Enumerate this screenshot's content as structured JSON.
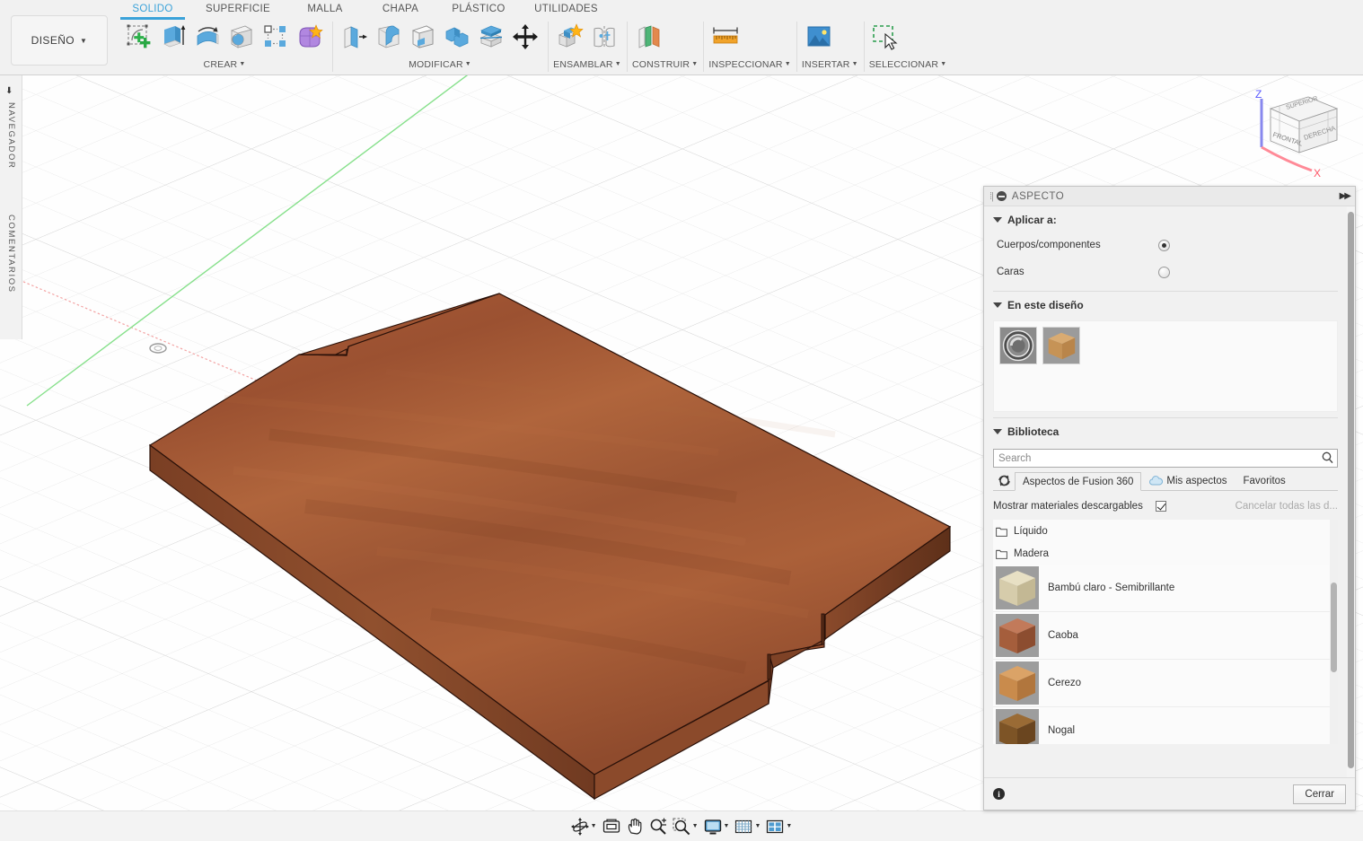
{
  "app": {
    "workspace_button": "DISEÑO",
    "ribbon_tabs": [
      {
        "label": "SOLIDO",
        "active": true
      },
      {
        "label": "SUPERFICIE",
        "active": false
      },
      {
        "label": "MALLA",
        "active": false
      },
      {
        "label": "CHAPA",
        "active": false
      },
      {
        "label": "PLÁSTICO",
        "active": false
      },
      {
        "label": "UTILIDADES",
        "active": false
      }
    ],
    "ribbon_groups": [
      {
        "label": "CREAR",
        "has_caret": true,
        "icons": [
          "create-sketch-icon",
          "extrude-icon",
          "revolve-icon",
          "sphere-hole-icon",
          "pattern-icon",
          "form-icon"
        ]
      },
      {
        "label": "MODIFICAR",
        "has_caret": true,
        "icons": [
          "press-pull-icon",
          "fillet-icon",
          "shell-icon",
          "combine-icon",
          "offset-face-icon",
          "move-copy-icon"
        ]
      },
      {
        "label": "ENSAMBLAR",
        "has_caret": true,
        "icons": [
          "new-component-icon",
          "joint-icon"
        ]
      },
      {
        "label": "CONSTRUIR",
        "has_caret": true,
        "icons": [
          "construct-plane-icon"
        ]
      },
      {
        "label": "INSPECCIONAR",
        "has_caret": true,
        "icons": [
          "measure-icon"
        ]
      },
      {
        "label": "INSERTAR",
        "has_caret": true,
        "icons": [
          "insert-image-icon"
        ]
      },
      {
        "label": "SELECCIONAR",
        "has_caret": true,
        "icons": [
          "window-selection-icon"
        ]
      }
    ]
  },
  "left_rail": {
    "navigator_label": "NAVEGADOR",
    "comments_label": "COMENTARIOS",
    "pin_icon": "pin-icon"
  },
  "viewcube": {
    "top_face": "SUPERIOR",
    "front_face": "FRONTAL",
    "right_face": "DERECHA",
    "axis_z": "Z",
    "axis_x": "X",
    "colors": {
      "z_axis": "#6a6aff",
      "x_axis": "#ff7d8a"
    }
  },
  "viewport": {
    "grid_color": "#e4e4e4",
    "background": "#fefefe",
    "x_axis_color": "#f08c8c",
    "y_axis_color": "#7fdb7f",
    "model_name": "wooden-board-body",
    "model_material_color": "#a85a35",
    "origin_marker": "origin-icon"
  },
  "navbar": {
    "items": [
      {
        "name": "orbit-icon",
        "caret": true
      },
      {
        "name": "look-at-icon",
        "caret": false
      },
      {
        "name": "pan-hand-icon",
        "caret": false
      },
      {
        "name": "zoom-icon",
        "caret": false
      },
      {
        "name": "zoom-window-icon",
        "caret": true
      },
      {
        "name": "display-settings-icon",
        "caret": true
      },
      {
        "name": "grid-snap-icon",
        "caret": true
      },
      {
        "name": "viewports-icon",
        "caret": true
      }
    ]
  },
  "aspect_dialog": {
    "title": "ASPECTO",
    "title_icons": {
      "grip": "drag-grip-icon",
      "minimize": "minimize-icon",
      "expand": "expand-arrows-icon"
    },
    "apply_to": {
      "section_label": "Aplicar a:",
      "options": [
        {
          "label": "Cuerpos/componentes",
          "selected": true
        },
        {
          "label": "Caras",
          "selected": false
        }
      ]
    },
    "in_this_design": {
      "section_label": "En este diseño",
      "swatches": [
        {
          "name": "steel-appearance-swatch",
          "type": "metal"
        },
        {
          "name": "wood-appearance-swatch",
          "type": "wood"
        }
      ]
    },
    "library": {
      "section_label": "Biblioteca",
      "search_placeholder": "Search",
      "search_value": "",
      "tabs": [
        {
          "label": "Aspectos de Fusion 360",
          "active": true,
          "icon": null
        },
        {
          "label": "Mis aspectos",
          "active": false,
          "icon": "cloud-icon"
        },
        {
          "label": "Favoritos",
          "active": false,
          "icon": null
        }
      ],
      "refresh_icon": "refresh-icon",
      "show_downloadable_label": "Mostrar materiales descargables",
      "show_downloadable_checked": true,
      "cancel_downloads_label": "Cancelar todas las d...",
      "folders": [
        {
          "label": "Líquido"
        },
        {
          "label": "Madera"
        }
      ],
      "materials": [
        {
          "label": "Bambú claro - Semibrillante",
          "c1": "#e8e0c4",
          "c2": "#d6ccab",
          "c3": "#c3b894"
        },
        {
          "label": "Caoba",
          "c1": "#c27a5a",
          "c2": "#a55e3c",
          "c3": "#8c4d30"
        },
        {
          "label": "Cerezo",
          "c1": "#dba367",
          "c2": "#c98b4c",
          "c3": "#b1763d"
        },
        {
          "label": "Nogal",
          "c1": "#9a6b35",
          "c2": "#7d5426",
          "c3": "#6a451f"
        }
      ]
    },
    "footer": {
      "info_icon": "info-icon",
      "close_label": "Cerrar"
    }
  }
}
